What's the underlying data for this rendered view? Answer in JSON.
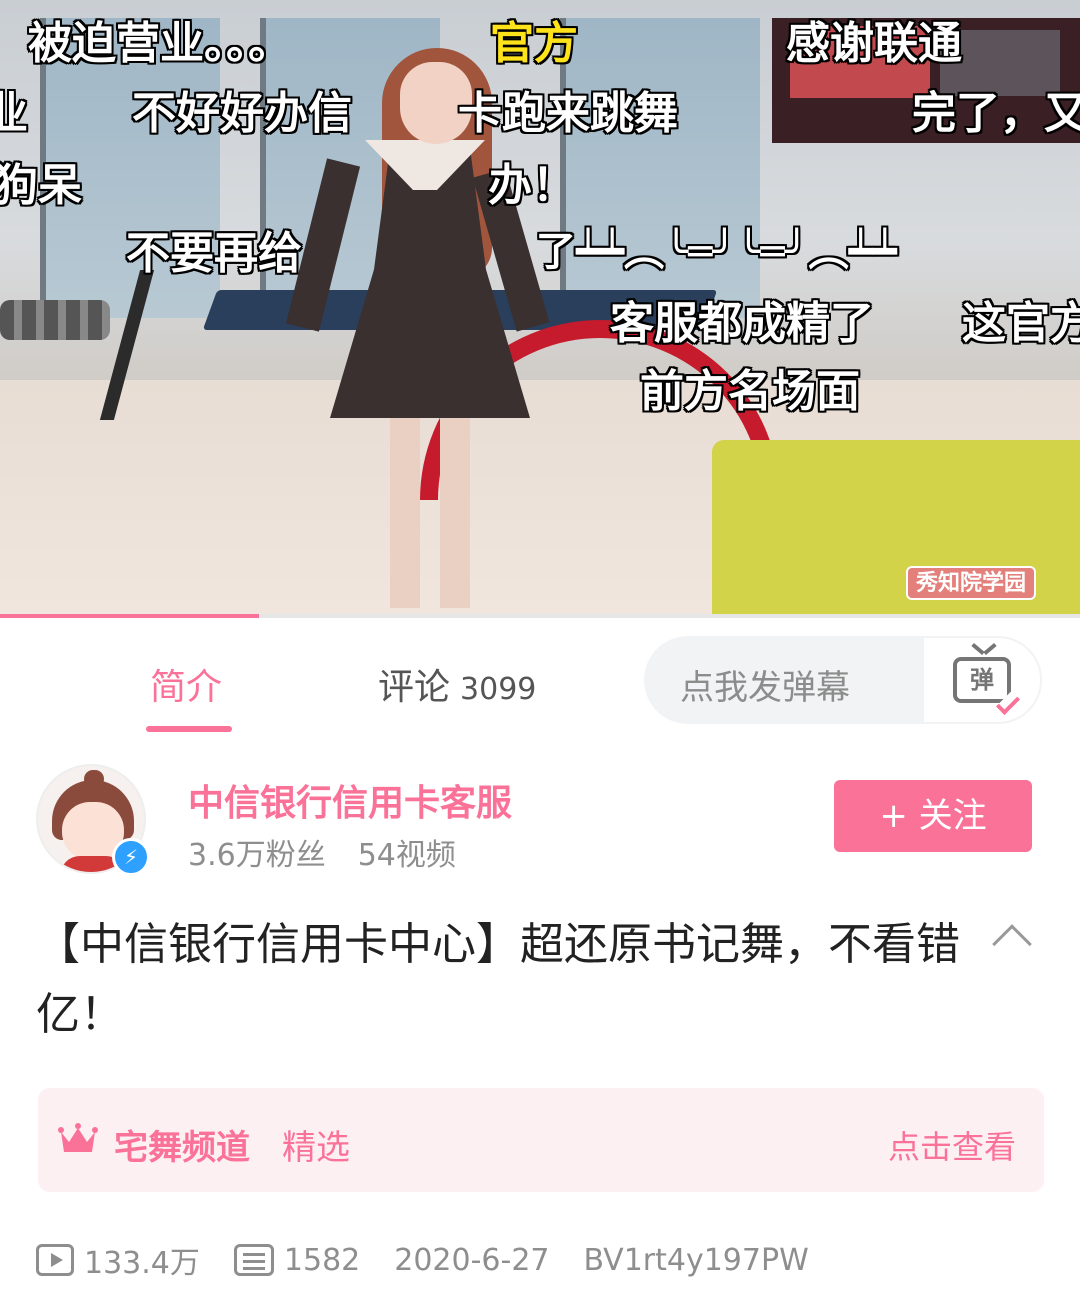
{
  "player": {
    "danmaku": [
      {
        "text": "被迫营业。。。",
        "color": "white"
      },
      {
        "text": "官方",
        "color": "yellow"
      },
      {
        "text": "感谢联通",
        "color": "white"
      },
      {
        "text": "业",
        "color": "white"
      },
      {
        "text": "不好好办信",
        "color": "white"
      },
      {
        "text": "卡跑来跳舞",
        "color": "white"
      },
      {
        "text": "完了，又",
        "color": "white"
      },
      {
        "text": "狗呆",
        "color": "white"
      },
      {
        "text": "办！",
        "color": "white"
      },
      {
        "text": "不要再给",
        "color": "white"
      },
      {
        "text": "了┷┷︵╰═╯╰═╯︵┷┷",
        "color": "white"
      },
      {
        "text": "客服都成精了",
        "color": "white"
      },
      {
        "text": "这官方",
        "color": "white"
      },
      {
        "text": "前方名场面",
        "color": "white"
      }
    ],
    "watermark": "秀知院学园",
    "progress": 0.24
  },
  "tabs": {
    "intro": "简介",
    "comments_label": "评论",
    "comments_count": "3099",
    "danmu_placeholder": "点我发弹幕",
    "danmu_toggle_glyph": "弹"
  },
  "uploader": {
    "name": "中信银行信用卡客服",
    "fans": "3.6万粉丝",
    "videos": "54视频",
    "follow_label": "+ 关注"
  },
  "video": {
    "title": "【中信银行信用卡中心】超还原书记舞，不看错亿！"
  },
  "channel": {
    "name": "宅舞频道",
    "tag": "精选",
    "link": "点击查看"
  },
  "stats": {
    "views": "133.4万",
    "danmaku": "1582",
    "date": "2020-6-27",
    "bvid": "BV1rt4y197PW"
  },
  "colors": {
    "accent": "#fb7299",
    "yellow_danmaku": "#ffe31a",
    "verified": "#2ea0ff"
  },
  "icons": [
    "crown-icon",
    "play-count-icon",
    "danmaku-count-icon",
    "danmu-toggle-icon",
    "collapse-chevron-icon",
    "verified-bolt-icon"
  ]
}
